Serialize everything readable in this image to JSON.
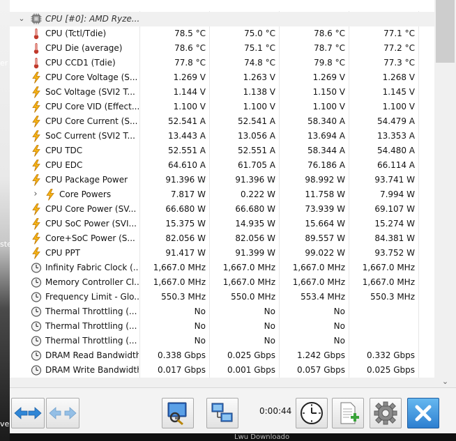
{
  "desktop": {
    "fragments": [
      "er",
      "ste",
      "ver"
    ]
  },
  "behind_window_text": "Lwu Downloado",
  "group": {
    "label": "CPU [#0]: AMD Ryze...",
    "expanded": true
  },
  "columns": [
    "Current",
    "Minimum",
    "Maximum",
    "Average"
  ],
  "rows": [
    {
      "icon": "thermometer-icon",
      "name": "CPU (Tctl/Tdie)",
      "values": [
        "78.5 °C",
        "75.0 °C",
        "78.6 °C",
        "77.1 °C"
      ]
    },
    {
      "icon": "thermometer-icon",
      "name": "CPU Die (average)",
      "values": [
        "78.6 °C",
        "75.1 °C",
        "78.7 °C",
        "77.2 °C"
      ]
    },
    {
      "icon": "thermometer-icon",
      "name": "CPU CCD1 (Tdie)",
      "values": [
        "77.8 °C",
        "74.8 °C",
        "79.8 °C",
        "77.3 °C"
      ]
    },
    {
      "icon": "lightning-icon",
      "name": "CPU Core Voltage (S...",
      "values": [
        "1.269 V",
        "1.263 V",
        "1.269 V",
        "1.268 V"
      ]
    },
    {
      "icon": "lightning-icon",
      "name": "SoC Voltage (SVI2 T...",
      "values": [
        "1.144 V",
        "1.138 V",
        "1.150 V",
        "1.145 V"
      ]
    },
    {
      "icon": "lightning-icon",
      "name": "CPU Core VID (Effect...",
      "values": [
        "1.100 V",
        "1.100 V",
        "1.100 V",
        "1.100 V"
      ]
    },
    {
      "icon": "lightning-icon",
      "name": "CPU Core Current (S...",
      "values": [
        "52.541 A",
        "52.541 A",
        "58.340 A",
        "54.479 A"
      ]
    },
    {
      "icon": "lightning-icon",
      "name": "SoC Current (SVI2 T...",
      "values": [
        "13.443 A",
        "13.056 A",
        "13.694 A",
        "13.353 A"
      ]
    },
    {
      "icon": "lightning-icon",
      "name": "CPU TDC",
      "values": [
        "52.551 A",
        "52.551 A",
        "58.344 A",
        "54.480 A"
      ]
    },
    {
      "icon": "lightning-icon",
      "name": "CPU EDC",
      "values": [
        "64.610 A",
        "61.705 A",
        "76.186 A",
        "66.114 A"
      ]
    },
    {
      "icon": "lightning-icon",
      "name": "CPU Package Power",
      "values": [
        "91.396 W",
        "91.396 W",
        "98.992 W",
        "93.741 W"
      ]
    },
    {
      "icon": "lightning-icon",
      "name": "Core Powers",
      "values": [
        "7.817 W",
        "0.222 W",
        "11.758 W",
        "7.994 W"
      ],
      "expandable": true
    },
    {
      "icon": "lightning-icon",
      "name": "CPU Core Power (SV...",
      "values": [
        "66.680 W",
        "66.680 W",
        "73.939 W",
        "69.107 W"
      ]
    },
    {
      "icon": "lightning-icon",
      "name": "CPU SoC Power (SVI...",
      "values": [
        "15.375 W",
        "14.935 W",
        "15.664 W",
        "15.274 W"
      ]
    },
    {
      "icon": "lightning-icon",
      "name": "Core+SoC Power (S...",
      "values": [
        "82.056 W",
        "82.056 W",
        "89.557 W",
        "84.381 W"
      ]
    },
    {
      "icon": "lightning-icon",
      "name": "CPU PPT",
      "values": [
        "91.417 W",
        "91.399 W",
        "99.022 W",
        "93.752 W"
      ]
    },
    {
      "icon": "clock-gauge-icon",
      "name": "Infinity Fabric Clock (...",
      "values": [
        "1,667.0 MHz",
        "1,667.0 MHz",
        "1,667.0 MHz",
        "1,667.0 MHz"
      ]
    },
    {
      "icon": "clock-gauge-icon",
      "name": "Memory Controller Cl...",
      "values": [
        "1,667.0 MHz",
        "1,667.0 MHz",
        "1,667.0 MHz",
        "1,667.0 MHz"
      ]
    },
    {
      "icon": "clock-gauge-icon",
      "name": "Frequency Limit - Glo...",
      "values": [
        "550.3 MHz",
        "550.0 MHz",
        "553.4 MHz",
        "550.3 MHz"
      ]
    },
    {
      "icon": "clock-gauge-icon",
      "name": "Thermal Throttling (...",
      "values": [
        "No",
        "No",
        "No",
        ""
      ]
    },
    {
      "icon": "clock-gauge-icon",
      "name": "Thermal Throttling (...",
      "values": [
        "No",
        "No",
        "No",
        ""
      ]
    },
    {
      "icon": "clock-gauge-icon",
      "name": "Thermal Throttling (...",
      "values": [
        "No",
        "No",
        "No",
        ""
      ]
    },
    {
      "icon": "clock-gauge-icon",
      "name": "DRAM Read Bandwidth",
      "values": [
        "0.338 Gbps",
        "0.025 Gbps",
        "1.242 Gbps",
        "0.332 Gbps"
      ]
    },
    {
      "icon": "clock-gauge-icon",
      "name": "DRAM Write Bandwidth",
      "values": [
        "0.017 Gbps",
        "0.001 Gbps",
        "0.057 Gbps",
        "0.025 Gbps"
      ]
    }
  ],
  "toolbar": {
    "elapsed_time": "0:00:44",
    "buttons": [
      {
        "name": "nav-arrows-button",
        "icon": "left-right-arrows-icon"
      },
      {
        "name": "nav-arrows-secondary-button",
        "icon": "left-right-arrows-faded-icon"
      },
      {
        "name": "search-monitor-button",
        "icon": "monitor-magnifier-icon"
      },
      {
        "name": "network-button",
        "icon": "network-computers-icon"
      },
      {
        "name": "reset-clock-button",
        "icon": "clock-icon"
      },
      {
        "name": "add-report-button",
        "icon": "document-add-icon"
      },
      {
        "name": "settings-button",
        "icon": "gear-icon"
      },
      {
        "name": "close-button",
        "icon": "close-x-icon"
      }
    ]
  },
  "colors": {
    "thermometer": "#c0392b",
    "lightning": "#f2a516",
    "close_button": "#2d7fd0",
    "group_background": "#f0f0f0"
  }
}
